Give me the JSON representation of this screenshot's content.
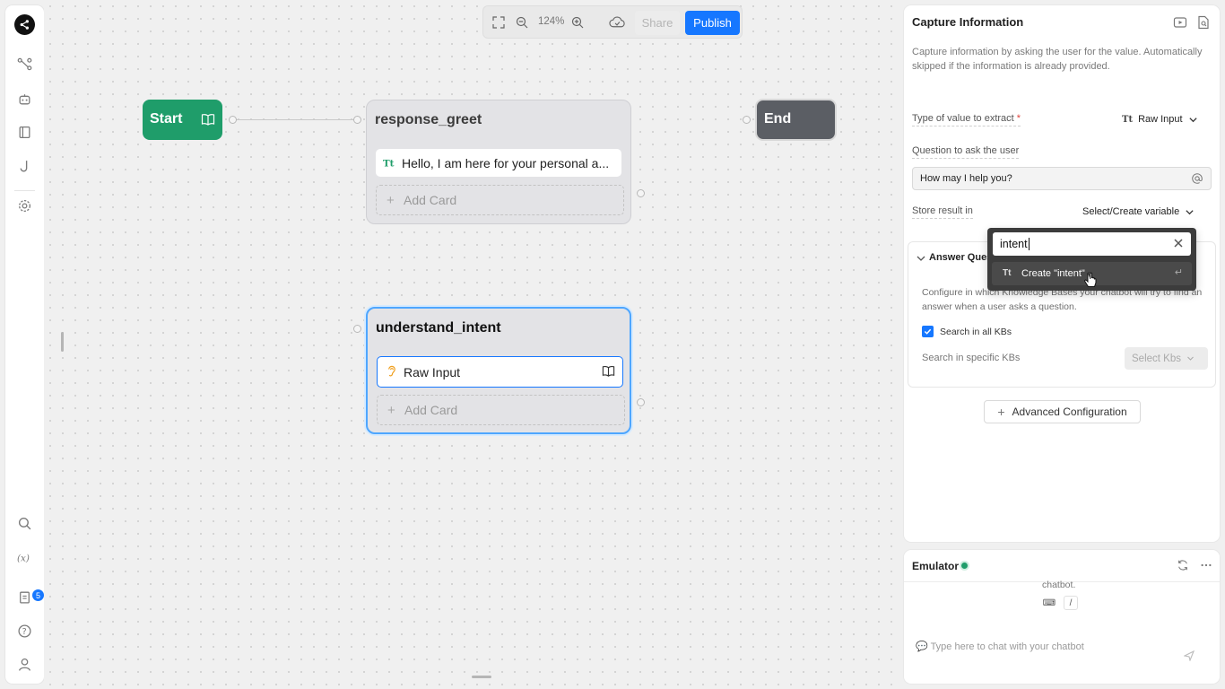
{
  "toolbar": {
    "zoom_label": "124%",
    "share_label": "Share",
    "publish_label": "Publish"
  },
  "nodes": {
    "start_label": "Start",
    "end_label": "End",
    "response_greet": {
      "title": "response_greet",
      "card_text": "Hello, I am here for your personal a...",
      "add_card": "Add Card"
    },
    "understand_intent": {
      "title": "understand_intent",
      "card_text": "Raw Input",
      "add_card": "Add Card"
    }
  },
  "panel": {
    "title": "Capture Information",
    "description": "Capture information by asking the user for the value. Automatically skipped if the information is already provided.",
    "type_label": "Type of value to extract",
    "required_mark": "*",
    "type_value_icon": "Tt",
    "type_value": "Raw Input",
    "question_label": "Question to ask the user",
    "question_value": "How may I help you?",
    "store_label": "Store result in",
    "store_value": "Select/Create variable",
    "answer_section_title": "Answer Ques",
    "answer_desc": "Configure in which Knowledge Bases your chatbot will try to find an answer when a user asks a question.",
    "search_all_label": "Search in all KBs",
    "search_specific_label": "Search in specific KBs",
    "select_kbs_label": "Select Kbs",
    "advanced_label": "Advanced Configuration"
  },
  "dropdown": {
    "search_value": "intent",
    "item_icon": "Tt",
    "item_label": "Create \"intent\"",
    "enter_hint": "↵"
  },
  "emulator": {
    "title": "Emulator",
    "fragment": "chatbot.",
    "kbd_key": "⌨",
    "slash_key": "/",
    "chat_placeholder": "Type here to chat with your chatbot"
  },
  "rail": {
    "badge_count": "5"
  },
  "colors": {
    "accent": "#1677ff",
    "start": "#1f9d6a",
    "end": "#5b5e64"
  }
}
